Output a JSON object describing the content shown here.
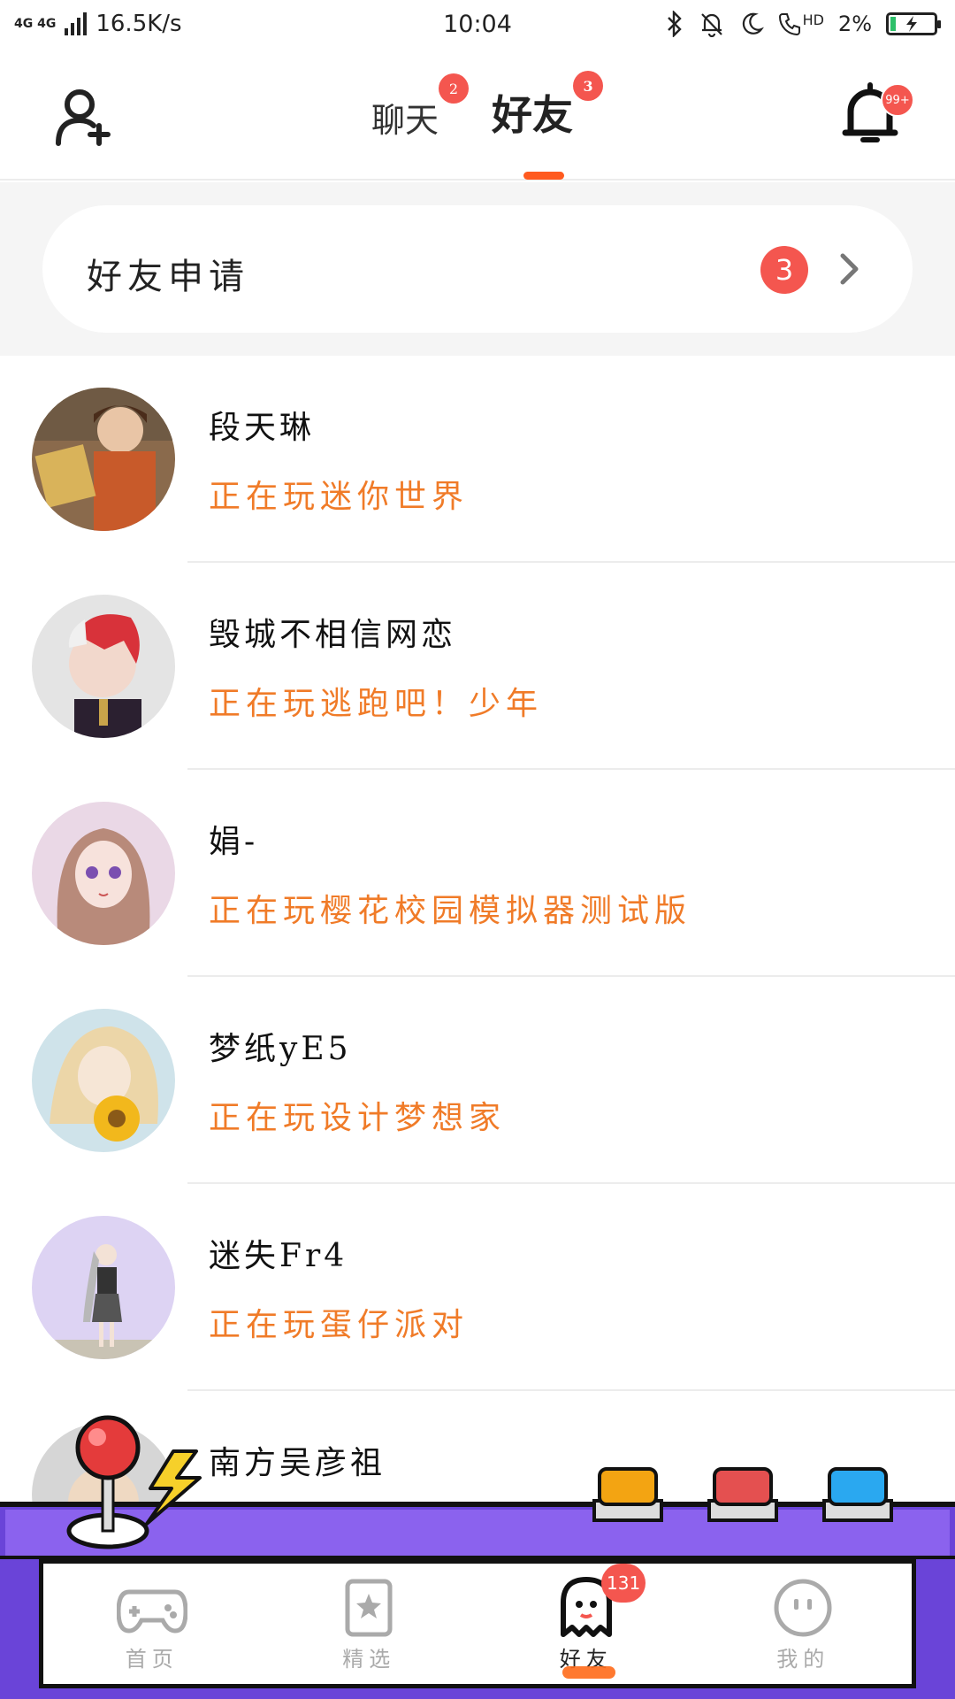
{
  "status_bar": {
    "network": "4G 4G",
    "speed": "16.5K/s",
    "time": "10:04",
    "hd": "HD",
    "battery": "2%"
  },
  "header": {
    "tabs": [
      {
        "label": "聊天",
        "badge": "2"
      },
      {
        "label": "好友",
        "badge": "3"
      }
    ],
    "active_tab": "好友",
    "bell_badge": "99+",
    "accent_color": "#ff5a1f"
  },
  "friend_request": {
    "label": "好友申请",
    "count": "3"
  },
  "friends": [
    {
      "name": "段天琳",
      "status": "正在玩迷你世界"
    },
    {
      "name": "毁城不相信网恋",
      "status": "正在玩逃跑吧！少年"
    },
    {
      "name": "娟-",
      "status": "正在玩樱花校园模拟器测试版"
    },
    {
      "name": "梦纸yE5",
      "status": "正在玩设计梦想家"
    },
    {
      "name": "迷失Fr4",
      "status": "正在玩蛋仔派对"
    },
    {
      "name": "南方吴彦祖",
      "status": ""
    }
  ],
  "bottom_nav": {
    "items": [
      {
        "label": "首页",
        "icon": "gamepad-icon"
      },
      {
        "label": "精选",
        "icon": "star-icon"
      },
      {
        "label": "好友",
        "icon": "ghost-icon",
        "badge": "131"
      },
      {
        "label": "我的",
        "icon": "face-icon"
      }
    ],
    "active": "好友"
  },
  "colors": {
    "badge": "#f4564f",
    "status_text": "#f07b28",
    "arcade_purple": "#7a52e6"
  }
}
